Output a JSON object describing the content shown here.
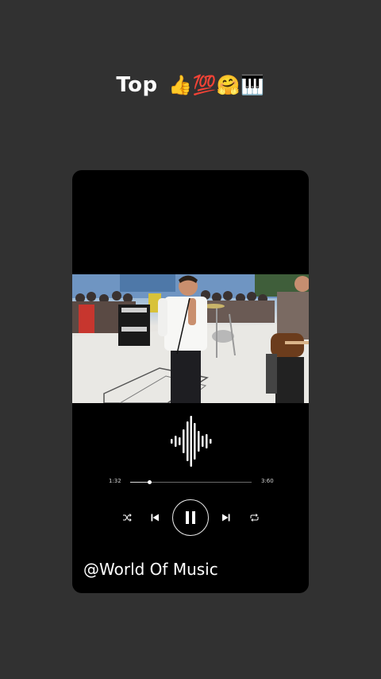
{
  "overlay": {
    "caption_text": "Top",
    "caption_emojis": "👍💯🤗🎹"
  },
  "player": {
    "elapsed_time": "1:32",
    "total_time": "3:60",
    "progress_fraction": 0.16,
    "state": "playing",
    "controls": [
      "shuffle-icon",
      "previous-icon",
      "pause-icon",
      "next-icon",
      "repeat-icon"
    ],
    "handle": "@World Of Music"
  },
  "colors": {
    "page_background": "#313131",
    "card_background": "#000000",
    "text": "#ffffff"
  }
}
